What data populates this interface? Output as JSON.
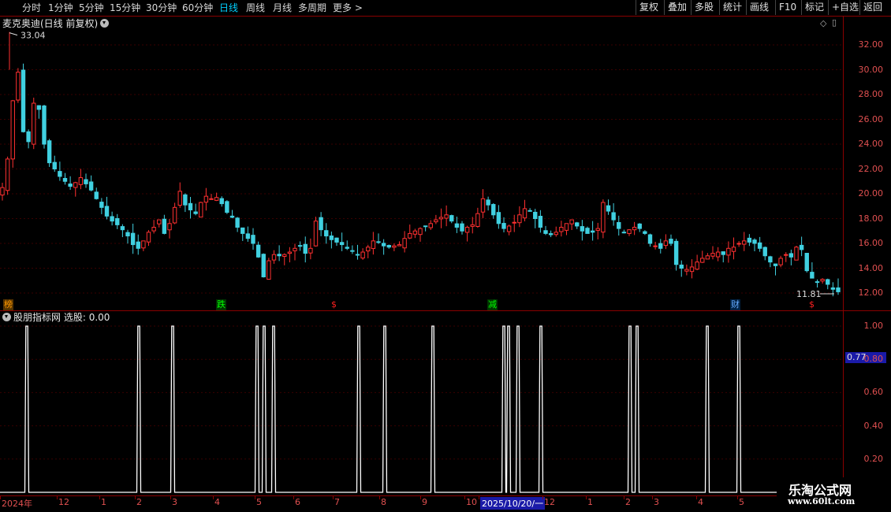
{
  "topbar": {
    "timeframes": [
      "分时",
      "1分钟",
      "5分钟",
      "15分钟",
      "30分钟",
      "60分钟",
      "日线",
      "周线",
      "月线",
      "多周期",
      "更多 >"
    ],
    "active_timeframe": "日线",
    "right_buttons": [
      "复权",
      "叠加",
      "多股",
      "统计",
      "画线",
      "F10",
      "标记",
      "+自选",
      "返回"
    ]
  },
  "stock": {
    "title": "麦克奥迪(日线 前复权)",
    "high_label": "33.04",
    "low_label": "11.81",
    "price_axis": [
      "32.00",
      "30.00",
      "28.00",
      "26.00",
      "24.00",
      "22.00",
      "20.00",
      "18.00",
      "16.00",
      "14.00",
      "12.00"
    ],
    "markers": [
      {
        "text": "榜",
        "color": "#ff9900",
        "bg": "#553300"
      },
      {
        "text": "跌",
        "color": "#00ff00",
        "bg": "#003300"
      },
      {
        "text": "$",
        "color": "#ff2020",
        "bg": ""
      },
      {
        "text": "减",
        "color": "#00ff00",
        "bg": "#003300"
      },
      {
        "text": "财",
        "color": "#66aaff",
        "bg": "#002244"
      },
      {
        "text": "$",
        "color": "#ff2020",
        "bg": ""
      }
    ]
  },
  "indicator": {
    "title": "股朋指标网",
    "value_text": "选股: 0.00",
    "axis": [
      "1.00",
      "0.80",
      "0.60",
      "0.40",
      "0.20"
    ],
    "current_value": "0.77"
  },
  "dates": [
    {
      "text": "2024年",
      "hl": false
    },
    {
      "text": "12",
      "hl": false
    },
    {
      "text": "1",
      "hl": false
    },
    {
      "text": "2",
      "hl": false
    },
    {
      "text": "3",
      "hl": false
    },
    {
      "text": "4",
      "hl": false
    },
    {
      "text": "5",
      "hl": false
    },
    {
      "text": "6",
      "hl": false
    },
    {
      "text": "7",
      "hl": false
    },
    {
      "text": "8",
      "hl": false
    },
    {
      "text": "9",
      "hl": false
    },
    {
      "text": "10",
      "hl": false
    },
    {
      "text": "2025/10/20/一",
      "hl": true
    },
    {
      "text": "12",
      "hl": false
    },
    {
      "text": "1",
      "hl": false
    },
    {
      "text": "2",
      "hl": false
    },
    {
      "text": "3",
      "hl": false
    },
    {
      "text": "4",
      "hl": false
    },
    {
      "text": "5",
      "hl": false
    }
  ],
  "watermark": {
    "line1": "乐淘公式网",
    "line2": "www.60lt.com"
  },
  "colors": {
    "up": "#ff3030",
    "down": "#40d0e0",
    "grid": "#8a0000",
    "signal": "#ffffff",
    "bg": "#000000"
  },
  "chart_data": {
    "type": "candlestick",
    "price_range": [
      11.81,
      33.04
    ],
    "closes": [
      20.5,
      22.8,
      27.5,
      29.8,
      25.0,
      24.2,
      27.3,
      26.8,
      24.0,
      22.5,
      22.0,
      21.4,
      21.0,
      20.6,
      20.9,
      21.3,
      20.8,
      20.3,
      19.6,
      18.9,
      18.2,
      17.8,
      17.5,
      17.1,
      16.6,
      15.9,
      15.6,
      16.2,
      16.9,
      17.3,
      17.9,
      16.8,
      17.6,
      18.9,
      20.2,
      19.1,
      18.7,
      18.4,
      19.3,
      19.8,
      19.6,
      19.7,
      19.2,
      18.5,
      18.1,
      17.3,
      16.8,
      16.4,
      16.0,
      14.9,
      13.3,
      14.6,
      15.1,
      15.0,
      15.1,
      15.3,
      15.6,
      15.8,
      15.2,
      15.6,
      17.8,
      17.1,
      16.6,
      16.3,
      16.1,
      15.9,
      15.6,
      15.4,
      15.1,
      15.3,
      15.7,
      16.2,
      16.1,
      15.8,
      15.7,
      15.8,
      15.9,
      16.4,
      16.8,
      17.0,
      17.2,
      17.4,
      17.6,
      17.9,
      18.1,
      18.3,
      17.8,
      17.3,
      17.0,
      17.3,
      17.5,
      18.4,
      19.6,
      19.1,
      18.3,
      17.6,
      17.2,
      17.4,
      17.7,
      18.3,
      18.8,
      18.6,
      18.0,
      17.3,
      16.8,
      16.7,
      16.9,
      17.3,
      17.6,
      17.9,
      17.4,
      17.0,
      16.8,
      16.9,
      17.2,
      19.3,
      18.6,
      17.9,
      17.2,
      16.9,
      17.1,
      17.3,
      17.2,
      16.8,
      16.0,
      15.8,
      15.6,
      16.2,
      16.0,
      14.3,
      14.0,
      13.9,
      14.1,
      14.5,
      14.8,
      15.0,
      15.2,
      15.3,
      15.1,
      15.6,
      15.7,
      16.0,
      16.2,
      16.1,
      16.0,
      15.6,
      15.0,
      14.5,
      14.2,
      14.8,
      15.1,
      14.9,
      15.7,
      15.5,
      13.8,
      13.2,
      12.9,
      13.1,
      12.7,
      12.3,
      12.1
    ]
  }
}
